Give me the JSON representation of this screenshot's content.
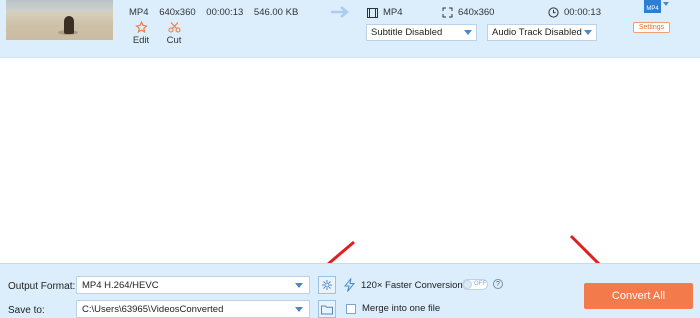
{
  "file": {
    "thumbnail": "beach-video-thumbnail",
    "source_format": "MP4",
    "source_resolution": "640x360",
    "source_duration": "00:00:13",
    "source_size": "546.00 KB",
    "edit_label": "Edit",
    "cut_label": "Cut",
    "output_format": "MP4",
    "output_resolution": "640x360",
    "output_duration": "00:00:13",
    "subtitle": "Subtitle Disabled",
    "audio_track": "Audio Track Disabled",
    "format_badge": "MP4",
    "settings_label": "Settings"
  },
  "bottom": {
    "output_format_label": "Output Format:",
    "output_format_value": "MP4 H.264/HEVC",
    "save_to_label": "Save to:",
    "save_to_value": "C:\\Users\\63965\\VideosConverted",
    "faster_conversion_label": "120× Faster Conversion",
    "toggle_state": "OFF",
    "help_glyph": "?",
    "merge_label": "Merge into one file",
    "convert_all_label": "Convert All"
  },
  "colors": {
    "accent_orange": "#f27a4b",
    "panel_blue": "#dceefc",
    "annotation_red": "#e02020"
  }
}
